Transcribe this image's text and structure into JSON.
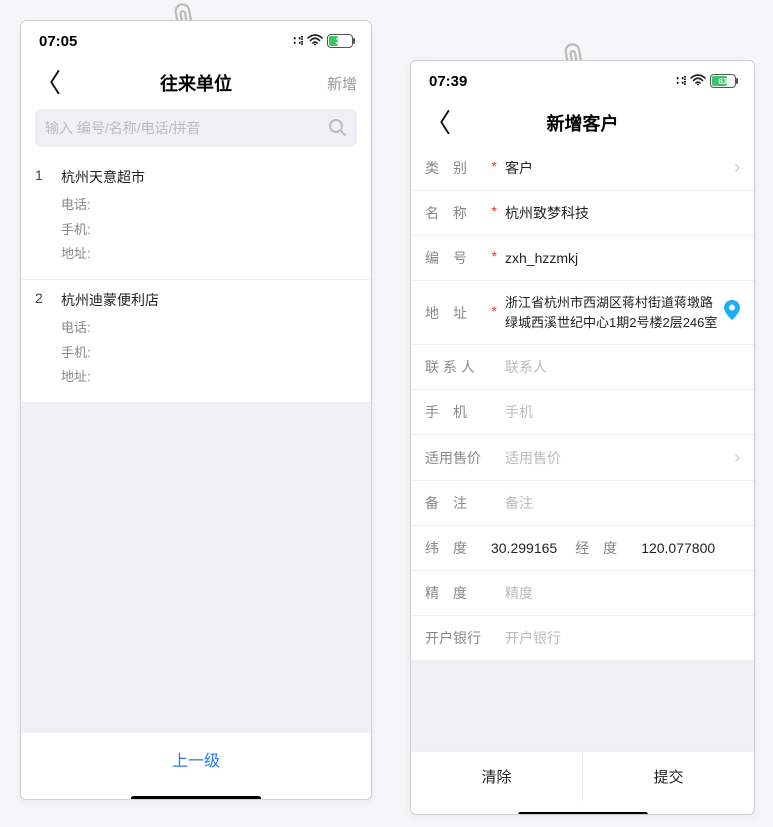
{
  "clip_icon": "paperclip",
  "left": {
    "status": {
      "time": "07:05",
      "battery_pct": "37"
    },
    "nav": {
      "title": "往来单位",
      "right": "新增"
    },
    "search_placeholder": "输入 编号/名称/电话/拼音",
    "list": [
      {
        "idx": "1",
        "name": "杭州天意超市",
        "tel_label": "电话:",
        "mob_label": "手机:",
        "addr_label": "地址:"
      },
      {
        "idx": "2",
        "name": "杭州迪蒙便利店",
        "tel_label": "电话:",
        "mob_label": "手机:",
        "addr_label": "地址:"
      }
    ],
    "footer": "上一级"
  },
  "right": {
    "status": {
      "time": "07:39",
      "battery_pct": "63"
    },
    "nav": {
      "title": "新增客户"
    },
    "rows": {
      "type": {
        "label": "类　别",
        "required": true,
        "value": "客户",
        "chevron": true
      },
      "name": {
        "label": "名　称",
        "required": true,
        "value": "杭州致梦科技"
      },
      "code": {
        "label": "编　号",
        "required": true,
        "value": "zxh_hzzmkj"
      },
      "addr": {
        "label": "地　址",
        "required": true,
        "value": "浙江省杭州市西湖区蒋村街道蒋墩路绿城西溪世纪中心1期2号楼2层246室",
        "location": true
      },
      "contact": {
        "label": "联 系 人",
        "placeholder": "联系人"
      },
      "mobile": {
        "label": "手　机",
        "placeholder": "手机"
      },
      "price": {
        "label": "适用售价",
        "placeholder": "适用售价",
        "chevron": true
      },
      "remark": {
        "label": "备　注",
        "placeholder": "备注"
      },
      "lat": {
        "label": "纬　度",
        "value": "30.299165"
      },
      "lon": {
        "label": "经　度",
        "value": "120.077800"
      },
      "prec": {
        "label": "精　度",
        "placeholder": "精度"
      },
      "bank": {
        "label": "开户银行",
        "placeholder": "开户银行"
      }
    },
    "buttons": {
      "clear": "清除",
      "submit": "提交"
    }
  }
}
